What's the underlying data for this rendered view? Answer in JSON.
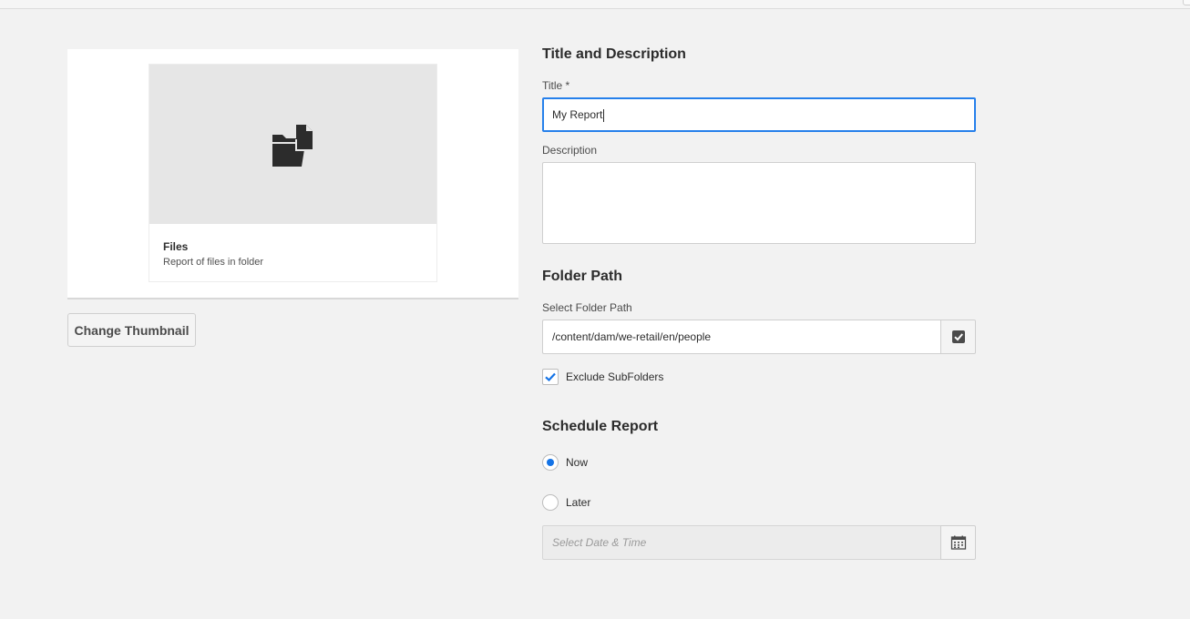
{
  "thumbnail": {
    "icon": "folder-file-icon",
    "title": "Files",
    "subtitle": "Report of files in folder",
    "change_button": "Change Thumbnail"
  },
  "title_description": {
    "heading": "Title and Description",
    "title_label": "Title *",
    "title_value": "My Report",
    "description_label": "Description",
    "description_value": ""
  },
  "folder_path": {
    "heading": "Folder Path",
    "label": "Select Folder Path",
    "value": "/content/dam/we-retail/en/people",
    "picker_icon": "checkbox-picker-icon",
    "exclude_label": "Exclude SubFolders",
    "exclude_checked": true
  },
  "schedule": {
    "heading": "Schedule Report",
    "options": [
      {
        "label": "Now",
        "selected": true
      },
      {
        "label": "Later",
        "selected": false
      }
    ],
    "datetime_placeholder": "Select Date & Time",
    "calendar_icon": "calendar-icon"
  },
  "colors": {
    "accent": "#1473e6",
    "focus": "#2680eb",
    "background": "#f2f2f2"
  }
}
